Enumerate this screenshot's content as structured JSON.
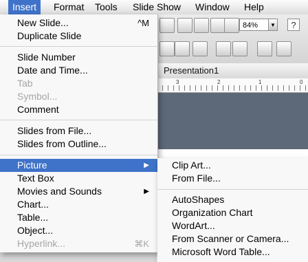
{
  "menubar": {
    "items": [
      "Insert",
      "Format",
      "Tools",
      "Slide Show",
      "Window",
      "Help"
    ]
  },
  "insert_menu": {
    "new_slide": "New Slide...",
    "new_slide_shortcut": "^M",
    "duplicate_slide": "Duplicate Slide",
    "slide_number": "Slide Number",
    "date_time": "Date and Time...",
    "tab": "Tab",
    "symbol": "Symbol...",
    "comment": "Comment",
    "slides_from_file": "Slides from File...",
    "slides_from_outline": "Slides from Outline...",
    "picture": "Picture",
    "text_box": "Text Box",
    "movies_sounds": "Movies and Sounds",
    "chart": "Chart...",
    "table": "Table...",
    "object": "Object...",
    "hyperlink": "Hyperlink...",
    "hyperlink_shortcut": "⌘K"
  },
  "picture_submenu": {
    "clip_art": "Clip Art...",
    "from_file": "From File...",
    "autoshapes": "AutoShapes",
    "org_chart": "Organization Chart",
    "wordart": "WordArt...",
    "scanner": "From Scanner or Camera...",
    "word_table": "Microsoft Word Table..."
  },
  "toolbar": {
    "zoom": "84%",
    "help_glyph": "?"
  },
  "document": {
    "title": "Presentation1"
  },
  "ruler": {
    "numbers": [
      "3",
      "2",
      "1",
      "0"
    ]
  },
  "colors": {
    "highlight": "#3f72c9",
    "canvas": "#5d6878"
  }
}
